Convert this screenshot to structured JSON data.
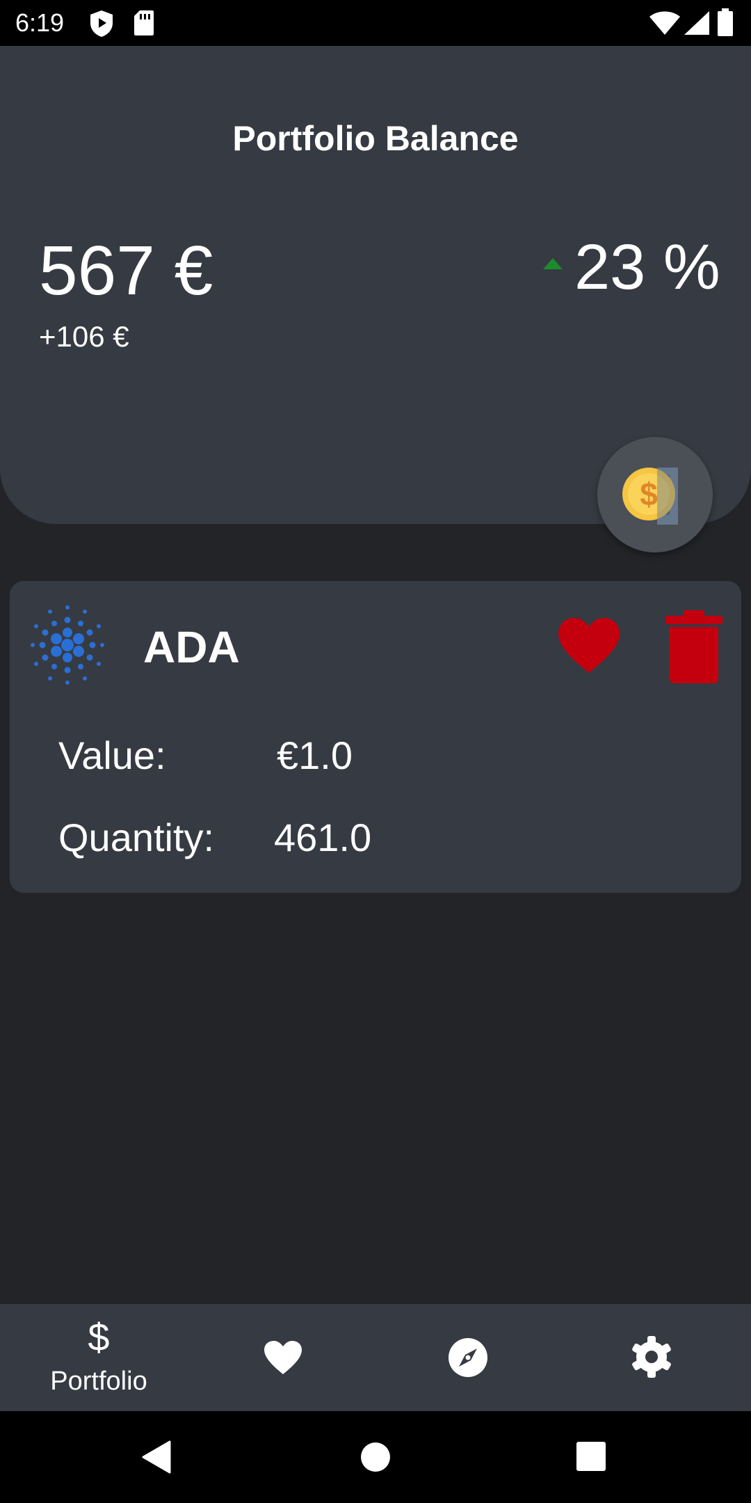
{
  "status_bar": {
    "time": "6:19",
    "icons": [
      "shield-notification-icon",
      "sd-card-icon",
      "wifi-icon",
      "cellular-signal-icon",
      "battery-icon"
    ]
  },
  "header": {
    "title": "Portfolio Balance",
    "balance": "567 €",
    "change": "+106 €",
    "percent": "23 %",
    "trend": "up",
    "trend_color": "#1c8c2a",
    "fab_icon": "coin-deposit-icon"
  },
  "coin": {
    "symbol": "ADA",
    "logo_icon": "cardano-logo-icon",
    "logo_color": "#2a6fd4",
    "value_label": "Value:",
    "value": "€1.0",
    "quantity_label": "Quantity:",
    "quantity": "461.0",
    "favorite_icon": "heart-icon",
    "delete_icon": "trash-icon",
    "action_color": "#c4000f"
  },
  "bottom_nav": {
    "items": [
      {
        "id": "portfolio",
        "icon": "dollar-icon",
        "label": "Portfolio",
        "active": true
      },
      {
        "id": "favorites",
        "icon": "heart-icon",
        "label": ""
      },
      {
        "id": "explore",
        "icon": "compass-icon",
        "label": ""
      },
      {
        "id": "settings",
        "icon": "gear-icon",
        "label": ""
      }
    ]
  },
  "colors": {
    "background": "#222428",
    "card": "#363a42",
    "nav": "#363a42"
  }
}
